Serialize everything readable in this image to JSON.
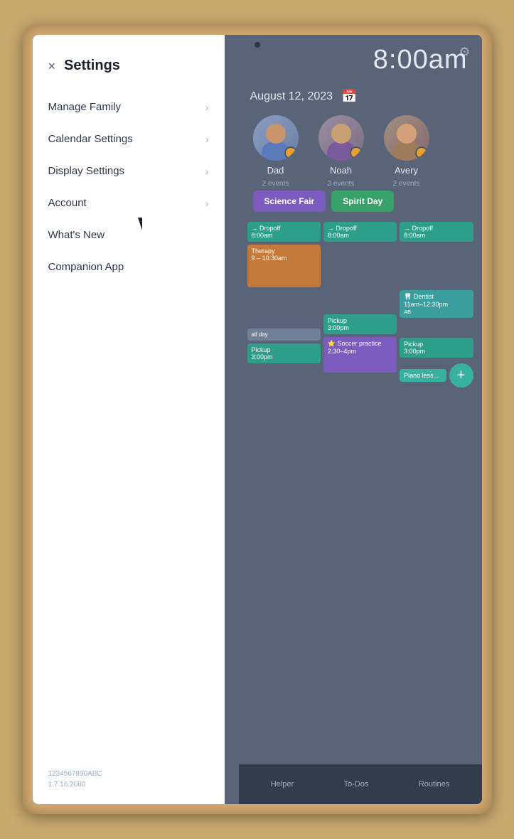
{
  "device": {
    "camera_alt": "front camera"
  },
  "clock": {
    "time": "8:00am"
  },
  "calendar": {
    "date": "August 12, 2023",
    "icon": "📅"
  },
  "avatars": [
    {
      "name": "Dad",
      "sub": "2 events",
      "color": "dad"
    },
    {
      "name": "Noah",
      "sub": "3 events",
      "color": "noah"
    },
    {
      "name": "Avery",
      "sub": "2 events",
      "color": "avery"
    }
  ],
  "events": [
    {
      "label": "Science Fair",
      "color": "purple"
    },
    {
      "label": "Spirit Day",
      "color": "green"
    }
  ],
  "calendar_events": [
    {
      "label": "→ Dropoff\n8:00am",
      "color": "teal"
    },
    {
      "label": "→ Dropoff\n8:00am",
      "color": "teal"
    },
    {
      "label": "→ Dropoff\n8:00am",
      "color": "teal"
    },
    {
      "label": "Therapy\n9 – 10:30am",
      "color": "orange"
    },
    {
      "label": "Dentist\n11am–12:30pm",
      "color": "blue-green"
    },
    {
      "label": "Pickup",
      "color": "teal"
    },
    {
      "label": "Pickup",
      "color": "teal"
    },
    {
      "label": "Pickup",
      "color": "teal"
    },
    {
      "label": "⭐ Soccer practice\n2:30–4pm",
      "color": "purple-ev"
    },
    {
      "label": "Piano less...",
      "color": "mint"
    }
  ],
  "bottom_tabs": [
    {
      "label": "Helper"
    },
    {
      "label": "To-Dos"
    },
    {
      "label": "Routines"
    }
  ],
  "settings": {
    "title": "Settings",
    "close_label": "×",
    "menu_items": [
      {
        "label": "Manage Family",
        "has_chevron": true
      },
      {
        "label": "Calendar Settings",
        "has_chevron": true
      },
      {
        "label": "Display Settings",
        "has_chevron": true
      },
      {
        "label": "Account",
        "has_chevron": true
      },
      {
        "label": "What's New",
        "has_chevron": false
      },
      {
        "label": "Companion App",
        "has_chevron": false
      }
    ],
    "version": "1234567890ABC\n1.7.16.2080"
  }
}
